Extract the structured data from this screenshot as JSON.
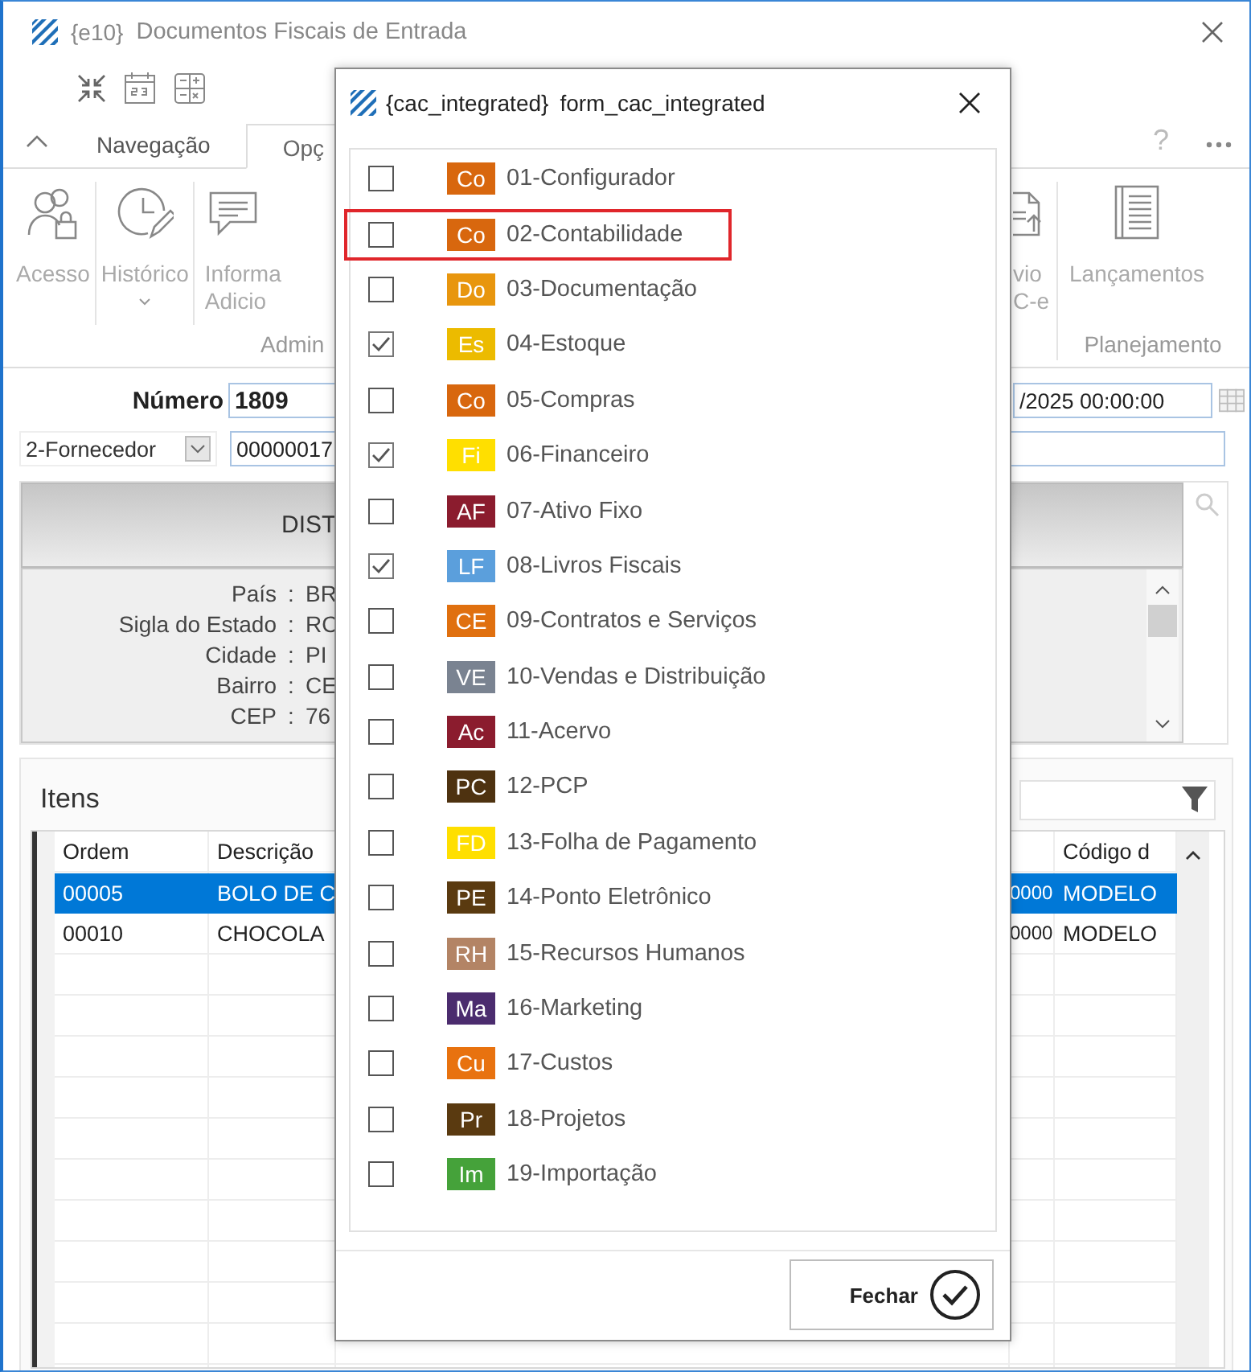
{
  "window": {
    "app_tag": "{e10}",
    "title": "Documentos Fiscais de Entrada"
  },
  "ribbon": {
    "tabs": [
      {
        "label": "Navegação",
        "selected": false
      },
      {
        "label": "Opç",
        "selected": true
      }
    ],
    "help": "?",
    "left_group": {
      "label": "Admin",
      "buttons": [
        {
          "lines": [
            "Acesso"
          ],
          "dropdown": false
        },
        {
          "lines": [
            "Histórico"
          ],
          "dropdown": true
        },
        {
          "lines": [
            "Informa",
            "Adicio"
          ],
          "dropdown": false
        }
      ]
    },
    "partial_button": {
      "lines": [
        "vio",
        "C-e"
      ]
    },
    "right_group": {
      "label": "Planejamento",
      "buttons": [
        {
          "lines": [
            "Lançamentos"
          ],
          "dropdown": false
        }
      ]
    }
  },
  "form": {
    "numero_label": "Número",
    "numero": "1809",
    "date": "/2025 00:00:00",
    "party_type": "2-Fornecedor",
    "party_code": "00000017"
  },
  "address_panel": {
    "title": "DIST",
    "fields": [
      {
        "label": "País",
        "sep": ":",
        "value": "BR"
      },
      {
        "label": "Sigla do Estado",
        "sep": ":",
        "value": "RO"
      },
      {
        "label": "Cidade",
        "sep": ":",
        "value": "PI"
      },
      {
        "label": "Bairro",
        "sep": ":",
        "value": "CE"
      },
      {
        "label": "CEP",
        "sep": ":",
        "value": "76"
      }
    ]
  },
  "items": {
    "title": "Itens",
    "columns": {
      "ordem": "Ordem",
      "descricao": "Descrição",
      "codigo": "Código d"
    },
    "rows": [
      {
        "ordem": "00005",
        "descricao": "BOLO DE C",
        "column_3": "0000",
        "codigo": "MODELO",
        "selected": true
      },
      {
        "ordem": "00010",
        "descricao": "CHOCOLA",
        "column_3": "0000",
        "codigo": "MODELO",
        "selected": false
      }
    ]
  },
  "dialog": {
    "title_tag": "{cac_integrated}",
    "title": "form_cac_integrated",
    "button": "Fechar",
    "items": [
      {
        "code": "Co",
        "label": "01-Configurador",
        "color": "#d8670e",
        "checked": false,
        "highlighted": false
      },
      {
        "code": "Co",
        "label": "02-Contabilidade",
        "color": "#d8670e",
        "checked": false,
        "highlighted": true
      },
      {
        "code": "Do",
        "label": "03-Documentação",
        "color": "#e8960e",
        "checked": false,
        "highlighted": false
      },
      {
        "code": "Es",
        "label": "04-Estoque",
        "color": "#ecbb00",
        "checked": true,
        "highlighted": false
      },
      {
        "code": "Co",
        "label": "05-Compras",
        "color": "#d8670e",
        "checked": false,
        "highlighted": false
      },
      {
        "code": "Fi",
        "label": "06-Financeiro",
        "color": "#ffdf00",
        "checked": true,
        "highlighted": false
      },
      {
        "code": "AF",
        "label": "07-Ativo Fixo",
        "color": "#8b1c2e",
        "checked": false,
        "highlighted": false
      },
      {
        "code": "LF",
        "label": "08-Livros Fiscais",
        "color": "#5b9fdc",
        "checked": true,
        "highlighted": false
      },
      {
        "code": "CE",
        "label": "09-Contratos e Serviços",
        "color": "#e0700f",
        "checked": false,
        "highlighted": false
      },
      {
        "code": "VE",
        "label": "10-Vendas e Distribuição",
        "color": "#7a8391",
        "checked": false,
        "highlighted": false
      },
      {
        "code": "Ac",
        "label": "11-Acervo",
        "color": "#8b1c2e",
        "checked": false,
        "highlighted": false
      },
      {
        "code": "PC",
        "label": "12-PCP",
        "color": "#4e3210",
        "checked": false,
        "highlighted": false
      },
      {
        "code": "FD",
        "label": "13-Folha de Pagamento",
        "color": "#ffdf00",
        "checked": false,
        "highlighted": false
      },
      {
        "code": "PE",
        "label": "14-Ponto Eletrônico",
        "color": "#5a3a10",
        "checked": false,
        "highlighted": false
      },
      {
        "code": "RH",
        "label": "15-Recursos Humanos",
        "color": "#b38465",
        "checked": false,
        "highlighted": false
      },
      {
        "code": "Ma",
        "label": "16-Marketing",
        "color": "#4b2c6e",
        "checked": false,
        "highlighted": false
      },
      {
        "code": "Cu",
        "label": "17-Custos",
        "color": "#e8720f",
        "checked": false,
        "highlighted": false
      },
      {
        "code": "Pr",
        "label": "18-Projetos",
        "color": "#5a3a10",
        "checked": false,
        "highlighted": false
      },
      {
        "code": "Im",
        "label": "19-Importação",
        "color": "#45a23a",
        "checked": false,
        "highlighted": false
      }
    ]
  }
}
